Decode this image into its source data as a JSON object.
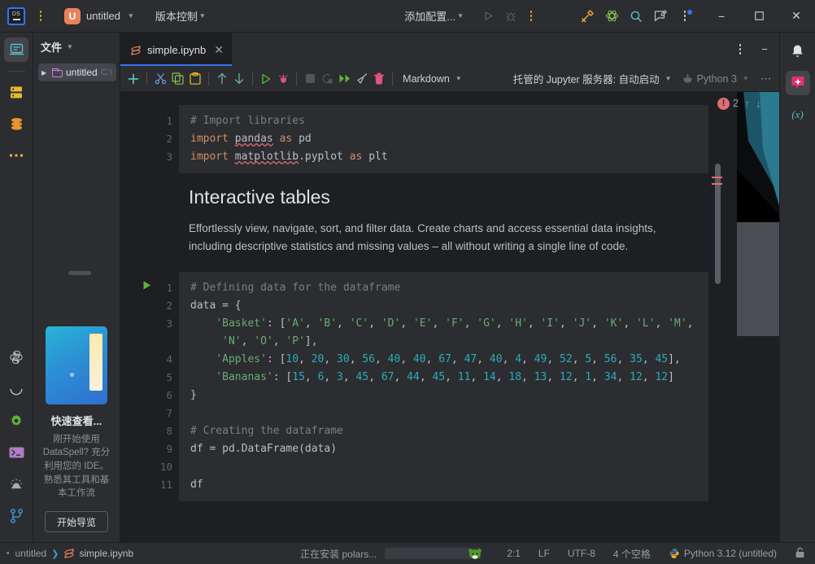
{
  "titlebar": {
    "logo_text": "DS",
    "project_initial": "U",
    "project_name": "untitled",
    "vcs_label": "版本控制",
    "run_config": "添加配置...",
    "icons": [
      {
        "name": "run-icon",
        "glyph": "▷"
      },
      {
        "name": "debug-icon",
        "glyph": "bug"
      },
      {
        "name": "more-actions-icon",
        "glyph": "kebab"
      },
      {
        "name": "tools-icon",
        "glyph": "hammer"
      },
      {
        "name": "science-atom-icon",
        "glyph": "atom"
      },
      {
        "name": "search-icon",
        "glyph": "magnifier"
      },
      {
        "name": "feedback-icon",
        "glyph": "pencil-note"
      },
      {
        "name": "main-menu-icon",
        "glyph": "kebab-dot"
      }
    ],
    "window_minimize": "−",
    "window_maximize": "▢",
    "window_close": "✕"
  },
  "left_rail": {
    "top_items": [
      {
        "name": "workspace-icon",
        "label": "工作区"
      },
      {
        "name": "database-server-icon",
        "label": "服务器"
      },
      {
        "name": "database-icon",
        "label": "数据库"
      },
      {
        "name": "more-tool-windows-icon",
        "label": "更多"
      }
    ],
    "bottom_items": [
      {
        "name": "python-console-icon",
        "label": "Python 控制台"
      },
      {
        "name": "progress-arc-icon",
        "label": "进度"
      },
      {
        "name": "settings-gear-icon",
        "label": "设置"
      },
      {
        "name": "terminal-icon",
        "label": "终端"
      },
      {
        "name": "problems-icon",
        "label": "问题"
      },
      {
        "name": "git-branch-icon",
        "label": "Git"
      }
    ]
  },
  "toolwindow": {
    "title": "文件",
    "tree": [
      {
        "name": "untitled",
        "path": "C:\\",
        "expanded": false
      }
    ]
  },
  "promo": {
    "title": "快速查看...",
    "description": "刚开始使用 DataSpell? 充分利用您的 IDE。熟悉其工具和基本工作流",
    "button": "开始导览"
  },
  "tabs": [
    {
      "name": "simple.ipynb",
      "active": true,
      "close": "✕"
    }
  ],
  "notebook_toolbar": {
    "buttons": [
      {
        "name": "add-cell-button",
        "glyph": "+"
      },
      {
        "name": "cut-cell-button",
        "glyph": "scissors"
      },
      {
        "name": "copy-cell-button",
        "glyph": "copy"
      },
      {
        "name": "paste-cell-button",
        "glyph": "clipboard"
      },
      {
        "name": "move-cell-up-button",
        "glyph": "↑"
      },
      {
        "name": "move-cell-down-button",
        "glyph": "↓"
      },
      {
        "name": "run-cell-button",
        "glyph": "▷"
      },
      {
        "name": "debug-cell-button",
        "glyph": "bug"
      },
      {
        "name": "interrupt-kernel-button",
        "glyph": "■"
      },
      {
        "name": "restart-kernel-button",
        "glyph": "⟳"
      },
      {
        "name": "run-all-button",
        "glyph": "▶▶"
      },
      {
        "name": "clear-outputs-button",
        "glyph": "broom"
      },
      {
        "name": "delete-cell-button",
        "glyph": "trash"
      }
    ],
    "cell_type": "Markdown",
    "server": "托管的 Jupyter 服务器: 自动启动",
    "kernel": "Python 3",
    "more": "⋯"
  },
  "inspections": {
    "error_count": "2",
    "prev_glyph": "↑",
    "next_glyph": "↓"
  },
  "cells": [
    {
      "type": "code",
      "lines": [
        {
          "num": "1",
          "tokens": [
            {
              "t": "# Import libraries",
              "c": "cm"
            }
          ]
        },
        {
          "num": "2",
          "tokens": [
            {
              "t": "import",
              "c": "kw"
            },
            {
              "t": " ",
              "c": "op"
            },
            {
              "t": "pandas",
              "c": "id wavy"
            },
            {
              "t": " ",
              "c": "op"
            },
            {
              "t": "as",
              "c": "kw"
            },
            {
              "t": " ",
              "c": "op"
            },
            {
              "t": "pd",
              "c": "id"
            }
          ]
        },
        {
          "num": "3",
          "tokens": [
            {
              "t": "import",
              "c": "kw"
            },
            {
              "t": " ",
              "c": "op"
            },
            {
              "t": "matplotlib",
              "c": "id wavy"
            },
            {
              "t": ".",
              "c": "op"
            },
            {
              "t": "pyplot",
              "c": "id"
            },
            {
              "t": " ",
              "c": "op"
            },
            {
              "t": "as",
              "c": "kw"
            },
            {
              "t": " ",
              "c": "op"
            },
            {
              "t": "plt",
              "c": "id"
            }
          ]
        }
      ]
    },
    {
      "type": "markdown",
      "heading": "Interactive tables",
      "paragraph": "Effortlessly view, navigate, sort, and filter data. Create charts and access essential data insights, including descriptive statistics and missing values – all without writing a single line of code."
    },
    {
      "type": "code",
      "has_run_arrow": true,
      "lines": [
        {
          "num": "1",
          "tokens": [
            {
              "t": "# Defining data for the dataframe",
              "c": "cm"
            }
          ]
        },
        {
          "num": "2",
          "tokens": [
            {
              "t": "data",
              "c": "id"
            },
            {
              "t": " = {",
              "c": "op"
            }
          ]
        },
        {
          "num": "3",
          "tokens": [
            {
              "t": "    ",
              "c": "op"
            },
            {
              "t": "'Basket'",
              "c": "str"
            },
            {
              "t": ": [",
              "c": "op"
            },
            {
              "t": "'A'",
              "c": "str"
            },
            {
              "t": ", ",
              "c": "op"
            },
            {
              "t": "'B'",
              "c": "str"
            },
            {
              "t": ", ",
              "c": "op"
            },
            {
              "t": "'C'",
              "c": "str"
            },
            {
              "t": ", ",
              "c": "op"
            },
            {
              "t": "'D'",
              "c": "str"
            },
            {
              "t": ", ",
              "c": "op"
            },
            {
              "t": "'E'",
              "c": "str"
            },
            {
              "t": ", ",
              "c": "op"
            },
            {
              "t": "'F'",
              "c": "str"
            },
            {
              "t": ", ",
              "c": "op"
            },
            {
              "t": "'G'",
              "c": "str"
            },
            {
              "t": ", ",
              "c": "op"
            },
            {
              "t": "'H'",
              "c": "str"
            },
            {
              "t": ", ",
              "c": "op"
            },
            {
              "t": "'I'",
              "c": "str"
            },
            {
              "t": ", ",
              "c": "op"
            },
            {
              "t": "'J'",
              "c": "str"
            },
            {
              "t": ", ",
              "c": "op"
            },
            {
              "t": "'K'",
              "c": "str"
            },
            {
              "t": ", ",
              "c": "op"
            },
            {
              "t": "'L'",
              "c": "str"
            },
            {
              "t": ", ",
              "c": "op"
            },
            {
              "t": "'M'",
              "c": "str"
            },
            {
              "t": ",",
              "c": "op"
            }
          ]
        },
        {
          "num": "",
          "tokens": [
            {
              "t": "     ",
              "c": "op"
            },
            {
              "t": "'N'",
              "c": "str"
            },
            {
              "t": ", ",
              "c": "op"
            },
            {
              "t": "'O'",
              "c": "str"
            },
            {
              "t": ", ",
              "c": "op"
            },
            {
              "t": "'P'",
              "c": "str"
            },
            {
              "t": "],",
              "c": "op"
            }
          ]
        },
        {
          "num": "4",
          "tokens": [
            {
              "t": "    ",
              "c": "op"
            },
            {
              "t": "'Apples'",
              "c": "str"
            },
            {
              "t": ": [",
              "c": "op"
            },
            {
              "t": "10",
              "c": "num"
            },
            {
              "t": ", ",
              "c": "op"
            },
            {
              "t": "20",
              "c": "num"
            },
            {
              "t": ", ",
              "c": "op"
            },
            {
              "t": "30",
              "c": "num"
            },
            {
              "t": ", ",
              "c": "op"
            },
            {
              "t": "56",
              "c": "num"
            },
            {
              "t": ", ",
              "c": "op"
            },
            {
              "t": "40",
              "c": "num"
            },
            {
              "t": ", ",
              "c": "op"
            },
            {
              "t": "40",
              "c": "num"
            },
            {
              "t": ", ",
              "c": "op"
            },
            {
              "t": "67",
              "c": "num"
            },
            {
              "t": ", ",
              "c": "op"
            },
            {
              "t": "47",
              "c": "num"
            },
            {
              "t": ", ",
              "c": "op"
            },
            {
              "t": "40",
              "c": "num"
            },
            {
              "t": ", ",
              "c": "op"
            },
            {
              "t": "4",
              "c": "num"
            },
            {
              "t": ", ",
              "c": "op"
            },
            {
              "t": "49",
              "c": "num"
            },
            {
              "t": ", ",
              "c": "op"
            },
            {
              "t": "52",
              "c": "num"
            },
            {
              "t": ", ",
              "c": "op"
            },
            {
              "t": "5",
              "c": "num"
            },
            {
              "t": ", ",
              "c": "op"
            },
            {
              "t": "56",
              "c": "num"
            },
            {
              "t": ", ",
              "c": "op"
            },
            {
              "t": "35",
              "c": "num"
            },
            {
              "t": ", ",
              "c": "op"
            },
            {
              "t": "45",
              "c": "num"
            },
            {
              "t": "],",
              "c": "op"
            }
          ]
        },
        {
          "num": "5",
          "tokens": [
            {
              "t": "    ",
              "c": "op"
            },
            {
              "t": "'Bananas'",
              "c": "str"
            },
            {
              "t": ": [",
              "c": "op"
            },
            {
              "t": "15",
              "c": "num"
            },
            {
              "t": ", ",
              "c": "op"
            },
            {
              "t": "6",
              "c": "num"
            },
            {
              "t": ", ",
              "c": "op"
            },
            {
              "t": "3",
              "c": "num"
            },
            {
              "t": ", ",
              "c": "op"
            },
            {
              "t": "45",
              "c": "num"
            },
            {
              "t": ", ",
              "c": "op"
            },
            {
              "t": "67",
              "c": "num"
            },
            {
              "t": ", ",
              "c": "op"
            },
            {
              "t": "44",
              "c": "num"
            },
            {
              "t": ", ",
              "c": "op"
            },
            {
              "t": "45",
              "c": "num"
            },
            {
              "t": ", ",
              "c": "op"
            },
            {
              "t": "11",
              "c": "num"
            },
            {
              "t": ", ",
              "c": "op"
            },
            {
              "t": "14",
              "c": "num"
            },
            {
              "t": ", ",
              "c": "op"
            },
            {
              "t": "18",
              "c": "num"
            },
            {
              "t": ", ",
              "c": "op"
            },
            {
              "t": "13",
              "c": "num"
            },
            {
              "t": ", ",
              "c": "op"
            },
            {
              "t": "12",
              "c": "num"
            },
            {
              "t": ", ",
              "c": "op"
            },
            {
              "t": "1",
              "c": "num"
            },
            {
              "t": ", ",
              "c": "op"
            },
            {
              "t": "34",
              "c": "num"
            },
            {
              "t": ", ",
              "c": "op"
            },
            {
              "t": "12",
              "c": "num"
            },
            {
              "t": ", ",
              "c": "op"
            },
            {
              "t": "12",
              "c": "num"
            },
            {
              "t": "]",
              "c": "op"
            }
          ]
        },
        {
          "num": "6",
          "tokens": [
            {
              "t": "}",
              "c": "op"
            }
          ]
        },
        {
          "num": "7",
          "tokens": [
            {
              "t": "",
              "c": "op"
            }
          ]
        },
        {
          "num": "8",
          "tokens": [
            {
              "t": "# Creating the dataframe",
              "c": "cm"
            }
          ]
        },
        {
          "num": "9",
          "tokens": [
            {
              "t": "df",
              "c": "id"
            },
            {
              "t": " = ",
              "c": "op"
            },
            {
              "t": "pd",
              "c": "id"
            },
            {
              "t": ".",
              "c": "op"
            },
            {
              "t": "DataFrame",
              "c": "id"
            },
            {
              "t": "(",
              "c": "op"
            },
            {
              "t": "data",
              "c": "id"
            },
            {
              "t": ")",
              "c": "op"
            }
          ]
        },
        {
          "num": "10",
          "tokens": [
            {
              "t": "",
              "c": "op"
            }
          ]
        },
        {
          "num": "11",
          "tokens": [
            {
              "t": "df",
              "c": "id"
            }
          ]
        }
      ]
    }
  ],
  "dataframe": {
    "Basket": [
      "A",
      "B",
      "C",
      "D",
      "E",
      "F",
      "G",
      "H",
      "I",
      "J",
      "K",
      "L",
      "M",
      "N",
      "O",
      "P"
    ],
    "Apples": [
      10,
      20,
      30,
      56,
      40,
      40,
      67,
      47,
      40,
      4,
      49,
      52,
      5,
      56,
      35,
      45
    ],
    "Bananas": [
      15,
      6,
      3,
      45,
      67,
      44,
      45,
      11,
      14,
      18,
      13,
      12,
      1,
      34,
      12,
      12
    ]
  },
  "right_rail": {
    "items": [
      {
        "name": "notifications-bell-icon",
        "label": "通知"
      },
      {
        "name": "ai-assistant-icon",
        "label": "AI 助手",
        "active": true
      },
      {
        "name": "variables-icon",
        "label": "(x)"
      }
    ]
  },
  "statusbar": {
    "breadcrumb_project": "untitled",
    "breadcrumb_sep": "❯",
    "breadcrumb_file": "simple.ipynb",
    "progress_text": "正在安装 polars...",
    "caret": "2:1",
    "line_sep": "LF",
    "encoding": "UTF-8",
    "indent": "4 个空格",
    "interpreter": "Python 3.12 (untitled)",
    "lock_icon": "lock-icon"
  },
  "colors": {
    "accent": "#3574f0",
    "bg": "#1e1f22",
    "panel": "#2b2d30",
    "error": "#e06c75",
    "string": "#6aab73",
    "number": "#2aacb8",
    "keyword": "#cf8e6d"
  }
}
